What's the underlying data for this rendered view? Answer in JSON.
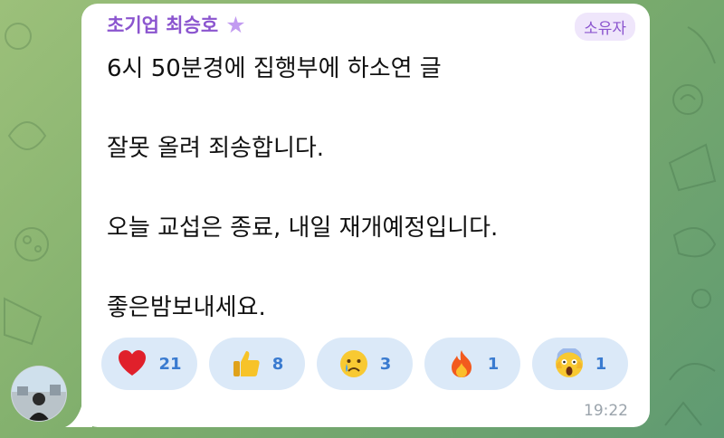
{
  "message": {
    "sender_name": "초기업 최승호",
    "sender_star": "★",
    "role_badge": "소유자",
    "lines": [
      "6시 50분경에 집행부에 하소연 글",
      "",
      "잘못 올려 죄송합니다.",
      "",
      "오늘 교섭은 종료, 내일 재개예정입니다.",
      "",
      "좋은밤보내세요."
    ],
    "time": "19:22"
  },
  "reactions": [
    {
      "icon": "red-heart-icon",
      "count": "21"
    },
    {
      "icon": "thumbs-up-icon",
      "count": "8"
    },
    {
      "icon": "crying-face-icon",
      "count": "3"
    },
    {
      "icon": "fire-icon",
      "count": "1"
    },
    {
      "icon": "screaming-face-icon",
      "count": "1"
    }
  ],
  "colors": {
    "sender": "#8b55cf",
    "badge_bg": "#efe6fb",
    "reaction_bg": "#dbe9f8",
    "reaction_count": "#3a7bd0",
    "background": "#7fae6c"
  }
}
